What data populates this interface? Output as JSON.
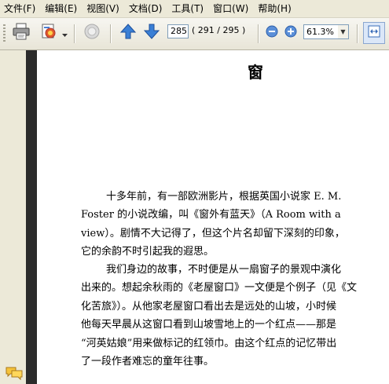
{
  "menu": [
    "文件(F)",
    "编辑(E)",
    "视图(V)",
    "文档(D)",
    "工具(T)",
    "窗口(W)",
    "帮助(H)"
  ],
  "toolbar": {
    "icons": [
      "print-icon",
      "email-icon",
      "hand-tool-icon",
      "prev-page-icon",
      "next-page-icon",
      "zoom-out-icon",
      "zoom-in-icon",
      "fit-width-icon"
    ],
    "page_current": "285",
    "page_count": "( 291 / 295 )",
    "zoom": "61.3%"
  },
  "document": {
    "title": "窗",
    "paragraph1": [
      "十多年前，有一部欧洲影片，根据英国小说家 E. M.",
      "Foster 的小说改编，叫《窗外有蓝天》（A Room with a",
      "view）。剧情不大记得了，但这个片名却留下深刻的印象，",
      "它的余韵不时引起我的遐思。"
    ],
    "paragraph2": [
      "我们身边的故事，不时便是从一扇窗子的景观中演化",
      "出来的。想起余秋雨的《老屋窗口》一文便是个例子（见《文",
      "化苦旅》）。从他家老屋窗口看出去是远处的山坡，小时候",
      "他每天早晨从这窗口看到山坡雪地上的一个红点——那是",
      "“河英姑娘”用来做标记的红领巾。由这个红点的记忆带出",
      "了一段作者难忘的童年往事。"
    ]
  }
}
